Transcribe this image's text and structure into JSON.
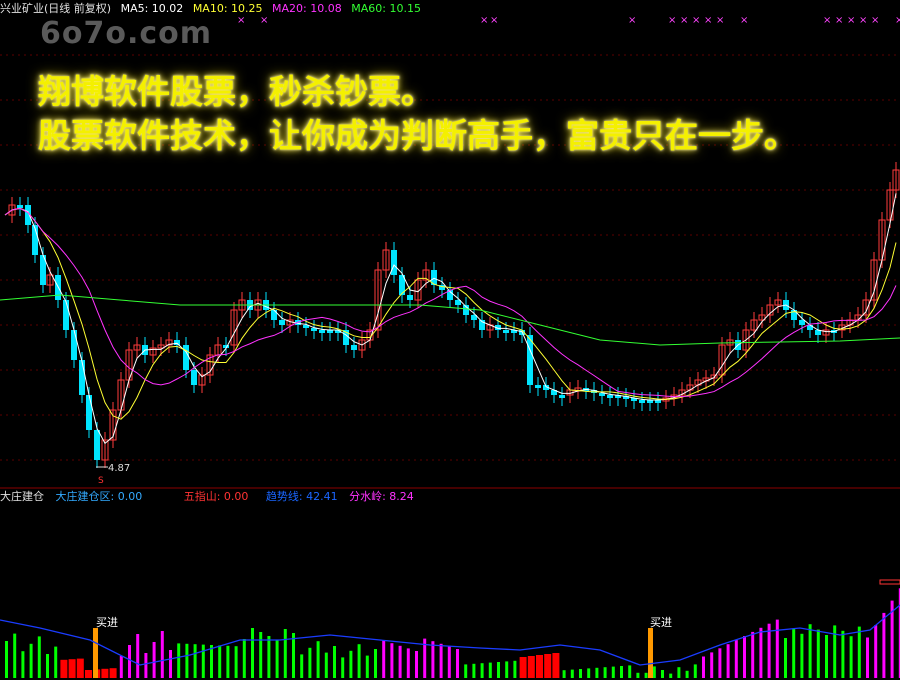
{
  "header": {
    "stock_title": "兴业矿业(日线 前复权)",
    "ma5": "MA5: 10.02",
    "ma10": "MA10: 10.25",
    "ma20": "MA20: 10.08",
    "ma60": "MA60: 10.15"
  },
  "watermark": "6o7o.com",
  "banner": {
    "line1": "翔博软件股票，秒杀钞票。",
    "line2": "股票软件技术，让你成为判断高手，富贵只在一步。"
  },
  "price_chart": {
    "low_label": "4.87",
    "low_marker": "S"
  },
  "indicator": {
    "name": "大庄建仓",
    "zone": "大庄建仓区: 0.00",
    "five_finger": "五指山: 0.00",
    "trend_line": "趋势线: 42.41",
    "watershed": "分水岭: 8.24",
    "buy_label_1": "买进",
    "buy_label_2": "买进"
  },
  "colors": {
    "up": "#ff3b3b",
    "down": "#00e5ff",
    "ma5": "#ffffff",
    "ma10": "#ffff33",
    "ma20": "#ff33ff",
    "ma60": "#33ff33",
    "green_bar": "#00ff00",
    "red_bar": "#ff0000",
    "magenta_bar": "#ff00ff",
    "orange_bar": "#ff9900",
    "blue_line": "#1a3cff"
  }
}
